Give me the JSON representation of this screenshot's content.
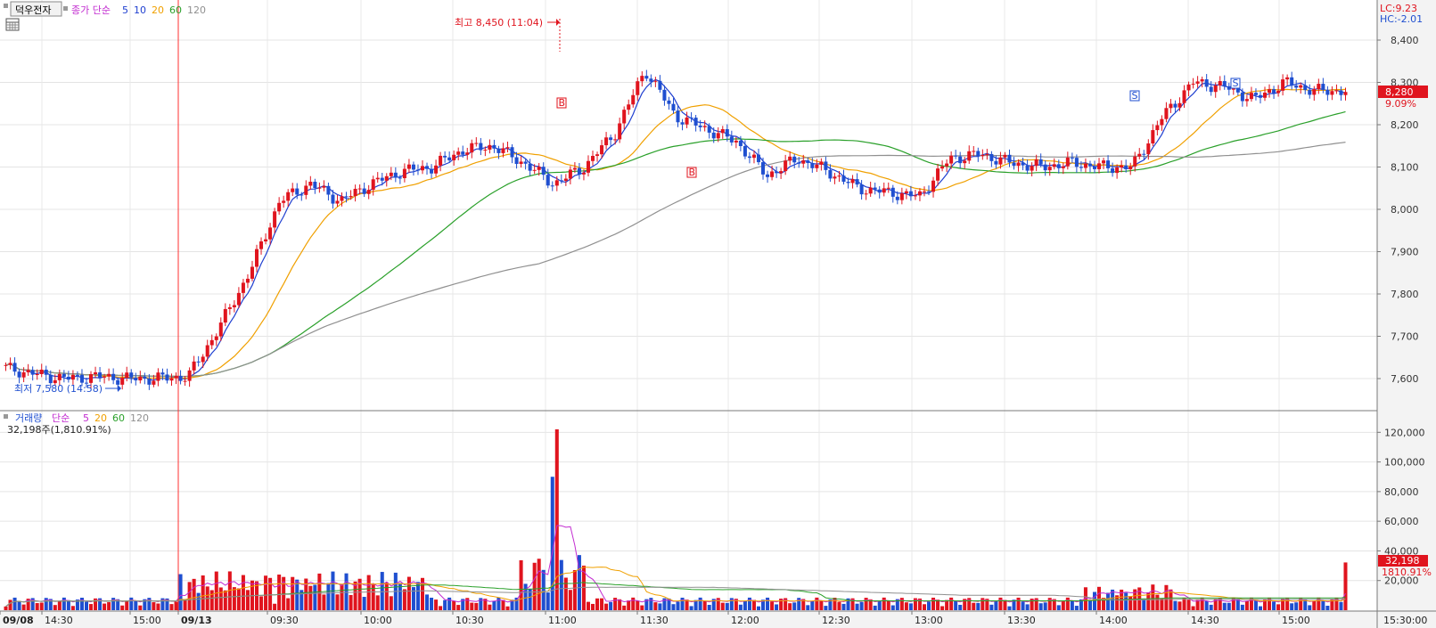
{
  "toolbar": {
    "stock_name": "덕우전자",
    "price_legend_prefix": "종가 단순",
    "ma_periods": [
      "5",
      "10",
      "20",
      "60",
      "120"
    ],
    "ma_colors": [
      "#1f3fd0",
      "#1f3fd0",
      "#f0a000",
      "#2aa02a",
      "#909090"
    ],
    "calendar_icon": "calendar-icon"
  },
  "price_panel": {
    "high_annotation": "최고 8,450 (11:04)",
    "low_annotation": "최저 7,580 (14:58)",
    "lc_label": "LC:9.23",
    "hc_label": "HC:-2.01",
    "current_price": "8,280",
    "current_change": "9.09%",
    "y_ticks": [
      "8,400",
      "8,300",
      "8,200",
      "8,100",
      "8,000",
      "7,900",
      "7,800",
      "7,700",
      "7,600"
    ],
    "up_color": "#e0141e",
    "down_color": "#1f4fd0",
    "signal_labels": [
      "B",
      "B",
      "S",
      "S"
    ]
  },
  "volume_panel": {
    "legend_title": "거래량",
    "legend_prefix": "단순",
    "ma_periods": [
      "5",
      "20",
      "60",
      "120"
    ],
    "summary": "32,198주(1,810.91%)",
    "current_volume": "32,198",
    "current_ratio": "1810.91%",
    "y_ticks": [
      "120,000",
      "100,000",
      "80,000",
      "60,000",
      "40,000",
      "20,000"
    ]
  },
  "time_axis": {
    "labels": [
      "09/08",
      "14:30",
      "15:00",
      "09/13",
      "09:30",
      "10:00",
      "10:30",
      "11:00",
      "11:30",
      "12:00",
      "12:30",
      "13:00",
      "13:30",
      "14:00",
      "14:30",
      "15:00"
    ],
    "corner_label": "15:30:00"
  },
  "chart_data": {
    "type": "candlestick",
    "price_range": [
      7550,
      8460
    ],
    "volume_range": [
      0,
      125000
    ],
    "high": 8450,
    "low": 7580,
    "last_close": 8280,
    "last_volume": 32198,
    "peak_volume": 122000,
    "close_path": [
      7625,
      7610,
      7600,
      7605,
      7600,
      7600,
      7605,
      7720,
      7850,
      8020,
      8060,
      8020,
      8060,
      8090,
      8100,
      8140,
      8150,
      8110,
      8060,
      8100,
      8180,
      8330,
      8220,
      8190,
      8160,
      8080,
      8120,
      8090,
      8050,
      8040,
      8030,
      8120,
      8130,
      8110,
      8100,
      8110,
      8100,
      8100,
      8220,
      8300,
      8290,
      8260,
      8300,
      8280,
      8280
    ]
  }
}
